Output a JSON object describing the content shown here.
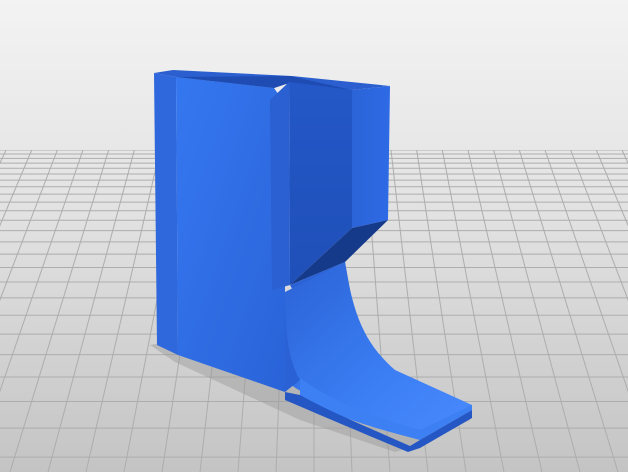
{
  "scene": {
    "description_visible": false,
    "colors": {
      "background_top": "#f2f2f2",
      "background_bottom": "#c9c9c9",
      "grid_line": "#a9a9a9",
      "part_front": "#2f6be0",
      "part_side": "#2456c4",
      "part_top": "#3f7ff0",
      "part_dark": "#1c3f98",
      "part_highlight": "#4a8cff",
      "shadow": "#8f8f8f"
    }
  }
}
